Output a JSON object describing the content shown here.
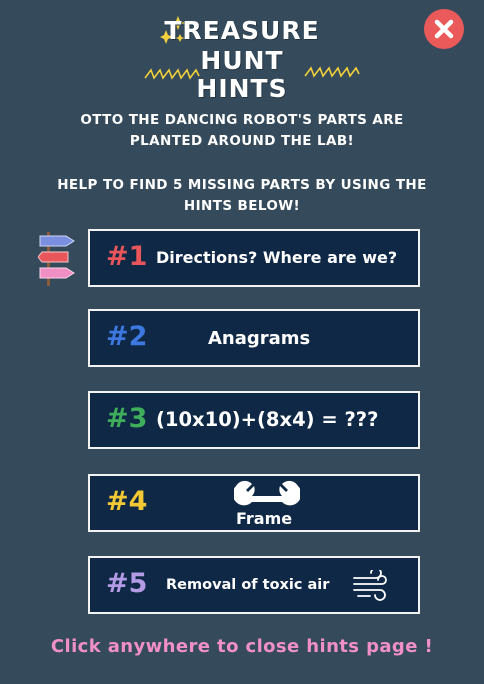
{
  "header": {
    "title_lines": [
      "TREASURE",
      "HUNT",
      "HINTS"
    ],
    "close_icon": "close-icon"
  },
  "intro": {
    "line1a": "OTTO THE DANCING ROBOT'S PARTS ARE",
    "line1b": "PLANTED AROUND THE LAB!",
    "line2a": "HELP TO FIND 5 MISSING PARTS BY USING THE",
    "line2b": "HINTS BELOW!"
  },
  "hints": [
    {
      "number": "#1",
      "text": "Directions? Where are we?",
      "color": "#e8555a",
      "icon": "direction-arrows-icon"
    },
    {
      "number": "#2",
      "text": "Anagrams",
      "color": "#3d78e0"
    },
    {
      "number": "#3",
      "text": "(10x10)+(8x4) = ???",
      "color": "#3fae5a"
    },
    {
      "number": "#4",
      "text": "Frame",
      "color": "#f3c832",
      "icon": "wrench-icon"
    },
    {
      "number": "#5",
      "text": "Removal of toxic air",
      "color": "#b49be6",
      "icon": "wind-icon"
    }
  ],
  "footer": {
    "text": "Click anywhere to close hints page !"
  },
  "colors": {
    "background": "#354b5c",
    "card": "#0e2846",
    "close": "#ea5a5a",
    "footer": "#f08fc8"
  }
}
